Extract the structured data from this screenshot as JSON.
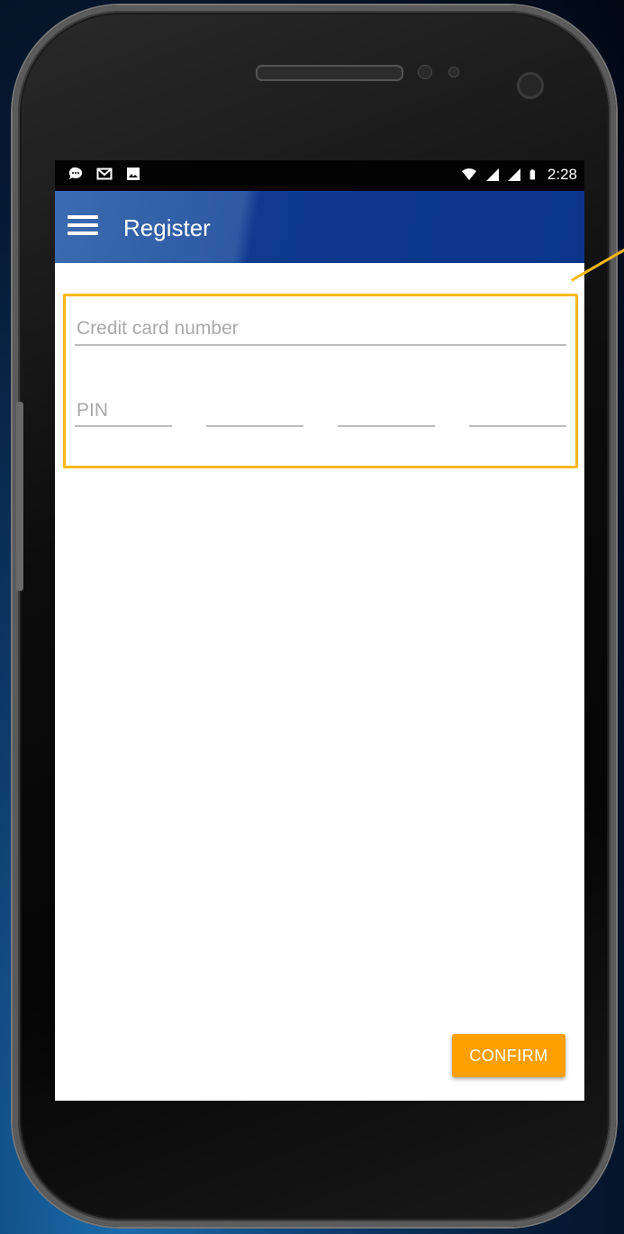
{
  "statusbar": {
    "notification_icons": [
      "chat-bubble-icon",
      "gmail-icon",
      "image-icon"
    ],
    "status_icons": [
      "wifi-icon",
      "signal-icon",
      "signal-icon",
      "battery-icon"
    ],
    "time": "2:28"
  },
  "appbar": {
    "title": "Register",
    "menu_icon": "hamburger-menu-icon"
  },
  "form": {
    "credit_card": {
      "placeholder": "Credit card number",
      "value": ""
    },
    "pin": {
      "placeholder": "PIN",
      "fields": [
        "",
        "",
        "",
        ""
      ]
    }
  },
  "actions": {
    "confirm_label": "CONFIRM"
  },
  "colors": {
    "appbar": "#0a358b",
    "accent": "#ffa000",
    "highlight": "#f7b81a"
  }
}
